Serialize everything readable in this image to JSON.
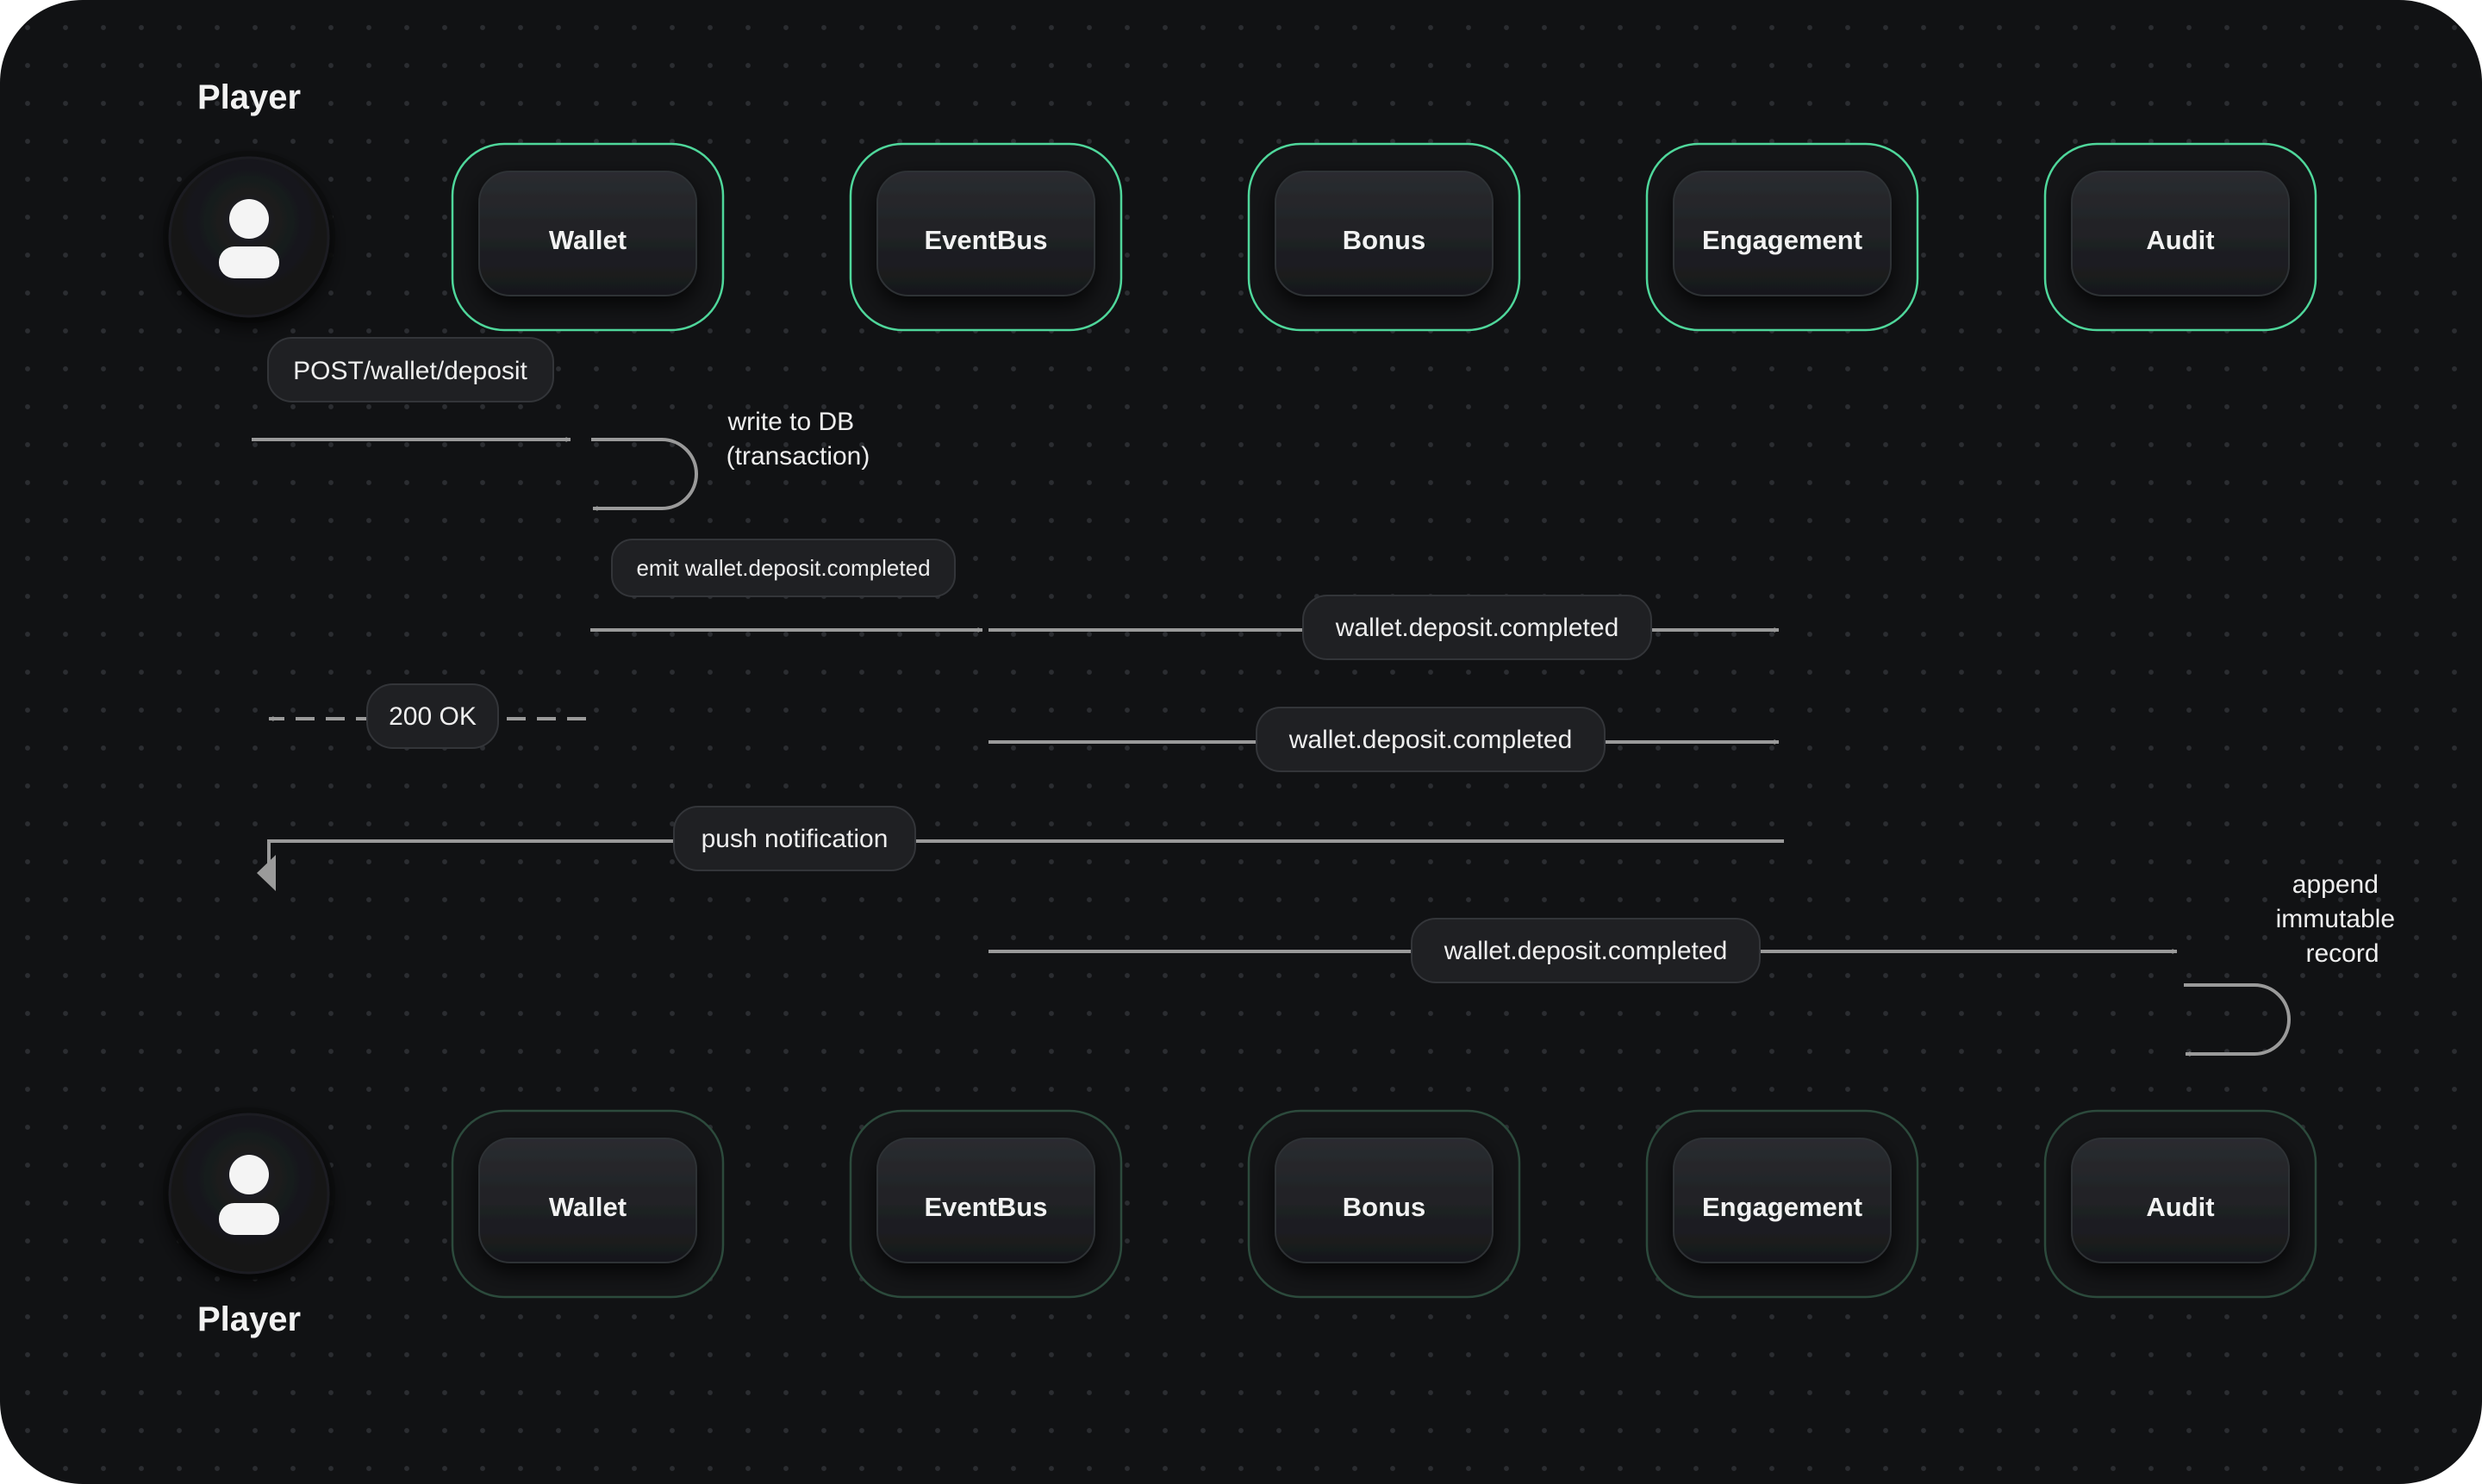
{
  "diagram": {
    "type": "sequence",
    "colors": {
      "background": "#111214",
      "lifeline": "#7cf0b8",
      "box_border": "#4fd79b",
      "arrow": "#9a9a9a",
      "text": "#eeeeee"
    },
    "player": {
      "top_label": "Player",
      "bottom_label": "Player",
      "icon": "user-icon"
    },
    "participants": [
      {
        "name": "Wallet"
      },
      {
        "name": "EventBus"
      },
      {
        "name": "Bonus"
      },
      {
        "name": "Engagement"
      },
      {
        "name": "Audit"
      }
    ],
    "messages": [
      {
        "label": "POST/wallet/deposit",
        "from": "Player",
        "to": "Wallet",
        "style": "solid"
      },
      {
        "label": "write to DB\n(transaction)",
        "from": "Wallet",
        "to": "Wallet",
        "style": "self"
      },
      {
        "label": "emit wallet.deposit.completed",
        "from": "Wallet",
        "to": "EventBus",
        "style": "solid"
      },
      {
        "label": "wallet.deposit.completed",
        "from": "EventBus",
        "to": "Engagement",
        "style": "solid"
      },
      {
        "label": "200 OK",
        "from": "Wallet",
        "to": "Player",
        "style": "dashed"
      },
      {
        "label": "wallet.deposit.completed",
        "from": "EventBus",
        "to": "Engagement",
        "style": "solid"
      },
      {
        "label": "push notification",
        "from": "Engagement",
        "to": "Player",
        "style": "solid"
      },
      {
        "label": "wallet.deposit.completed",
        "from": "EventBus",
        "to": "Audit",
        "style": "solid"
      },
      {
        "label": "append\nimmutable\nrecord",
        "from": "Audit",
        "to": "Audit",
        "style": "self"
      }
    ]
  }
}
